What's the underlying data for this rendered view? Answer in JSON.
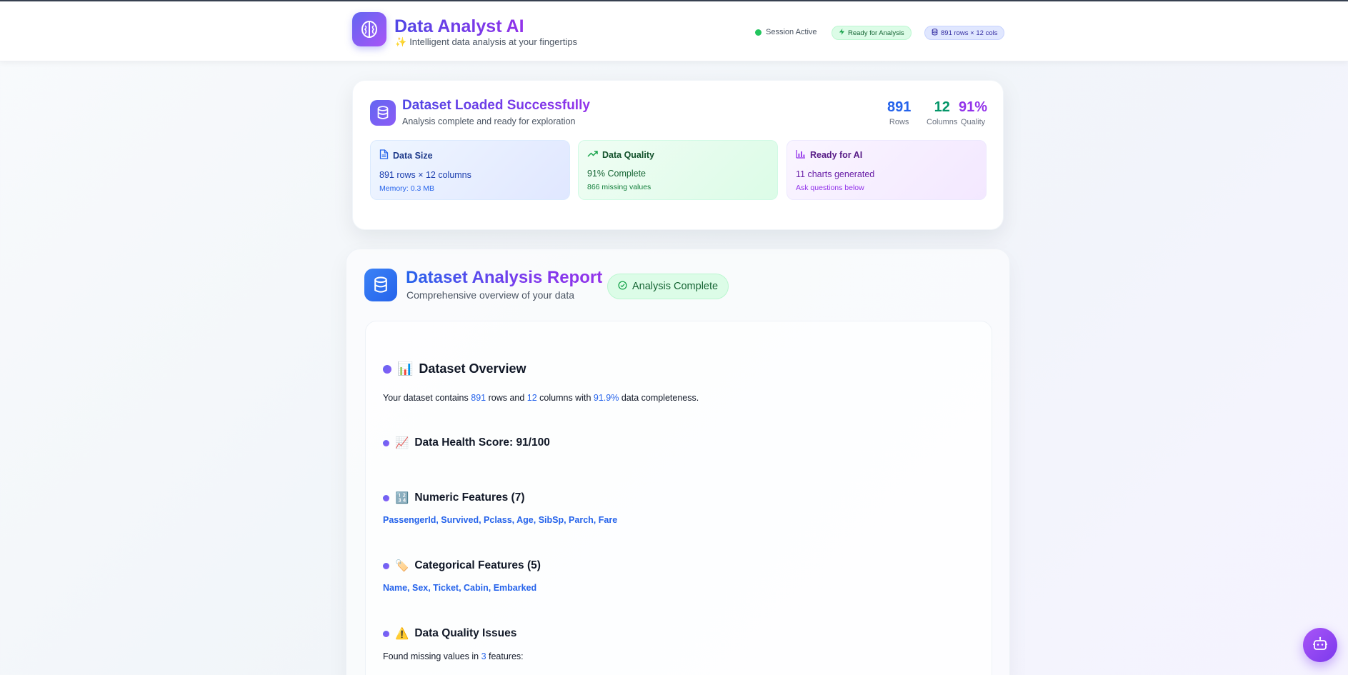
{
  "header": {
    "title": "Data Analyst AI",
    "subtitle": "Intelligent data analysis at your fingertips",
    "session_status": "Session Active",
    "ready_badge": "Ready for Analysis",
    "dims_badge": "891 rows × 12 cols"
  },
  "dataset_card": {
    "title": "Dataset Loaded Successfully",
    "subtitle": "Analysis complete and ready for exploration",
    "stats": [
      {
        "value": "891",
        "label": "Rows",
        "color": "#2563eb"
      },
      {
        "value": "12",
        "label": "Columns",
        "color": "#059669"
      },
      {
        "value": "91%",
        "label": "Quality",
        "color": "#9333ea"
      }
    ],
    "tiles": {
      "size": {
        "title": "Data Size",
        "line": "891 rows × 12 columns",
        "note": "Memory: 0.3 MB"
      },
      "quality": {
        "title": "Data Quality",
        "line": "91% Complete",
        "note": "866 missing values"
      },
      "ai": {
        "title": "Ready for AI",
        "line": "11 charts generated",
        "note": "Ask questions below"
      }
    }
  },
  "report": {
    "title": "Dataset Analysis Report",
    "subtitle": "Comprehensive overview of your data",
    "status_badge": "Analysis Complete",
    "overview": {
      "emoji": "📊",
      "heading": "Dataset Overview",
      "text_prefix": "Your dataset contains ",
      "rows": "891",
      "text_mid1": " rows and ",
      "cols": "12",
      "text_mid2": " columns with ",
      "completeness": "91.9%",
      "text_suffix": " data completeness."
    },
    "health": {
      "emoji": "📈",
      "heading": "Data Health Score: 91/100"
    },
    "numeric": {
      "emoji": "🔢",
      "heading": "Numeric Features (7)",
      "features": "PassengerId, Survived, Pclass, Age, SibSp, Parch, Fare"
    },
    "categorical": {
      "emoji": "🏷️",
      "heading": "Categorical Features (5)",
      "features": "Name, Sex, Ticket, Cabin, Embarked"
    },
    "issues": {
      "emoji": "⚠️",
      "heading": "Data Quality Issues",
      "text_prefix": "Found missing values in ",
      "count": "3",
      "text_suffix": " features:"
    }
  },
  "icons": {
    "logo": "brain-icon",
    "database": "database-icon",
    "fab": "bot-icon"
  }
}
